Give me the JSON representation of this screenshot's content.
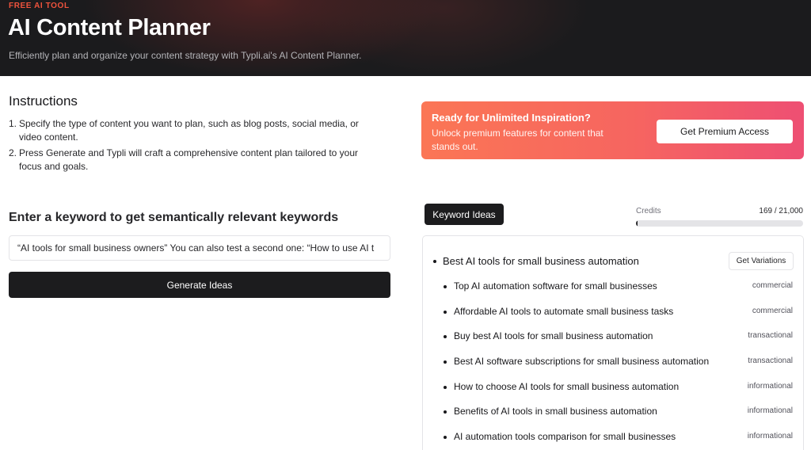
{
  "hero": {
    "eyebrow": "FREE AI TOOL",
    "title": "AI Content Planner",
    "subtitle": "Efficiently plan and organize your content strategy with Typli.ai's AI Content Planner."
  },
  "instructions": {
    "heading": "Instructions",
    "steps": [
      {
        "num": "1.",
        "text": "Specify the type of content you want to plan, such as blog posts, social media, or video content."
      },
      {
        "num": "2.",
        "text": "Press Generate and Typli will craft a comprehensive content plan tailored to your focus and goals."
      }
    ]
  },
  "keyword_form": {
    "heading": "Enter a keyword to get semantically relevant keywords",
    "input_value": "“AI tools for small business owners” You can also test a second one: “How to use AI t",
    "generate_label": "Generate Ideas"
  },
  "promo": {
    "title": "Ready for Unlimited Inspiration?",
    "text": "Unlock premium features for content that stands out.",
    "button_label": "Get Premium Access"
  },
  "results_header": {
    "tab_label": "Keyword Ideas",
    "credits_label": "Credits",
    "credits_value": "169 / 21,000",
    "credits_fraction": 0.008
  },
  "results": {
    "main_keyword": "Best AI tools for small business automation",
    "variations_label": "Get Variations",
    "items": [
      {
        "text": "Top AI automation software for small businesses",
        "tag": "commercial"
      },
      {
        "text": "Affordable AI tools to automate small business tasks",
        "tag": "commercial"
      },
      {
        "text": "Buy best AI tools for small business automation",
        "tag": "transactional"
      },
      {
        "text": "Best AI software subscriptions for small business automation",
        "tag": "transactional"
      },
      {
        "text": "How to choose AI tools for small business automation",
        "tag": "informational"
      },
      {
        "text": "Benefits of AI tools in small business automation",
        "tag": "informational"
      },
      {
        "text": "AI automation tools comparison for small businesses",
        "tag": "informational"
      }
    ]
  },
  "colors": {
    "hero_bg": "#1b1b1d",
    "eyebrow": "#f0533d",
    "promo_start": "#fb7655",
    "promo_end": "#ee4f73",
    "button_dark": "#1c1c1e"
  }
}
